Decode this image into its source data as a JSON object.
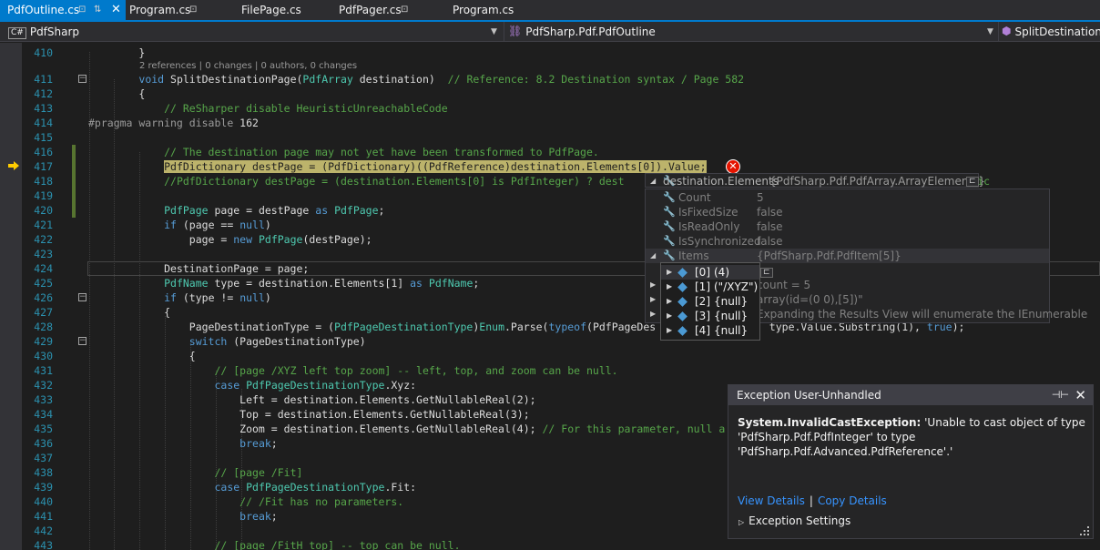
{
  "tabs": [
    {
      "label": "PdfOutline.cs",
      "active": true,
      "pinned": true,
      "close": "✕"
    },
    {
      "label": "Program.cs",
      "active": false,
      "pinned": true
    },
    {
      "label": "FilePage.cs",
      "active": false,
      "pinned": false
    },
    {
      "label": "PdfPager.cs",
      "active": false,
      "pinned": true
    },
    {
      "label": "Program.cs",
      "active": false,
      "pinned": false
    }
  ],
  "navbar": {
    "project_icon": "C#",
    "project": "PdfSharp",
    "type": "PdfSharp.Pdf.PdfOutline",
    "member": "SplitDestinationPage"
  },
  "codelens": "2 references | 0 changes | 0 authors, 0 changes",
  "lines": [
    {
      "n": "410",
      "html": "        }"
    },
    {
      "n": "411",
      "html": "        <span class=\"kw\">void</span> SplitDestinationPage(<span class=\"ty\">PdfArray</span> destination)  <span class=\"cm\">// Reference: 8.2 Destination syntax / Page 582</span>"
    },
    {
      "n": "412",
      "html": "        {"
    },
    {
      "n": "413",
      "html": "            <span class=\"cm\">// ReSharper disable HeuristicUnreachableCode</span>"
    },
    {
      "n": "414",
      "html": "<span class=\"pp\">#pragma warning disable</span> 162"
    },
    {
      "n": "415",
      "html": ""
    },
    {
      "n": "416",
      "html": "            <span class=\"cm\">// The destination page may not yet have been transformed to PdfPage.</span>"
    },
    {
      "n": "417",
      "html": "            <span class=\"hl\">PdfDictionary destPage = (PdfDictionary)((PdfReference)destination.Elements[0]).Value;</span>"
    },
    {
      "n": "418",
      "html": "            <span class=\"cm\">//PdfDictionary destPage = (destination.Elements[0] is PdfInteger) ? dest                                       ]).Value] : (PdfDic</span>"
    },
    {
      "n": "419",
      "html": ""
    },
    {
      "n": "420",
      "html": "            <span class=\"ty\">PdfPage</span> page = destPage <span class=\"kw\">as</span> <span class=\"ty\">PdfPage</span>;"
    },
    {
      "n": "421",
      "html": "            <span class=\"kw\">if</span> (page == <span class=\"kw\">null</span>)"
    },
    {
      "n": "422",
      "html": "                page = <span class=\"kw\">new</span> <span class=\"ty\">PdfPage</span>(destPage);"
    },
    {
      "n": "423",
      "html": ""
    },
    {
      "n": "424",
      "html": "            DestinationPage = page;"
    },
    {
      "n": "425",
      "html": "            <span class=\"ty\">PdfName</span> type = destination.Elements[1] <span class=\"kw\">as</span> <span class=\"ty\">PdfName</span>;"
    },
    {
      "n": "426",
      "html": "            <span class=\"kw\">if</span> (type != <span class=\"kw\">null</span>)"
    },
    {
      "n": "427",
      "html": "            {"
    },
    {
      "n": "428",
      "html": "                PageDestinationType = (<span class=\"ty\">PdfPageDestinationType</span>)<span class=\"ty\">Enum</span>.Parse(<span class=\"kw\">typeof</span>(PdfPageDes                  type.Value.Substring(1), <span class=\"kw\">true</span>);"
    },
    {
      "n": "429",
      "html": "                <span class=\"kw\">switch</span> (PageDestinationType)"
    },
    {
      "n": "430",
      "html": "                {"
    },
    {
      "n": "431",
      "html": "                    <span class=\"cm\">// [page /XYZ left top zoom] -- left, top, and zoom can be null.</span>"
    },
    {
      "n": "432",
      "html": "                    <span class=\"kw\">case</span> <span class=\"ty\">PdfPageDestinationType</span>.Xyz:"
    },
    {
      "n": "433",
      "html": "                        Left = destination.Elements.GetNullableReal(2);"
    },
    {
      "n": "434",
      "html": "                        Top = destination.Elements.GetNullableReal(3);"
    },
    {
      "n": "435",
      "html": "                        Zoom = destination.Elements.GetNullableReal(4); <span class=\"cm\">// For this parameter, null a</span>"
    },
    {
      "n": "436",
      "html": "                        <span class=\"kw\">break</span>;"
    },
    {
      "n": "437",
      "html": ""
    },
    {
      "n": "438",
      "html": "                    <span class=\"cm\">// [page /Fit]</span>"
    },
    {
      "n": "439",
      "html": "                    <span class=\"kw\">case</span> <span class=\"ty\">PdfPageDestinationType</span>.Fit:"
    },
    {
      "n": "440",
      "html": "                        <span class=\"cm\">// /Fit has no parameters.</span>"
    },
    {
      "n": "441",
      "html": "                        <span class=\"kw\">break</span>;"
    },
    {
      "n": "442",
      "html": ""
    },
    {
      "n": "443",
      "html": "                    <span class=\"cm\">// [page /FitH top] -- top can be null.</span>"
    }
  ],
  "datatip": {
    "header": {
      "name": "destination.Elements",
      "value": "{PdfSharp.Pdf.PdfArray.ArrayElements}"
    },
    "rows": [
      {
        "name": "Count",
        "value": "5"
      },
      {
        "name": "IsFixedSize",
        "value": "false"
      },
      {
        "name": "IsReadOnly",
        "value": "false"
      },
      {
        "name": "IsSynchronized",
        "value": "false"
      },
      {
        "name": "Items",
        "value": "{PdfSharp.Pdf.PdfItem[5]}"
      }
    ],
    "hidden_rows": [
      {
        "text": "count = 5"
      },
      {
        "text": "array(id=(0 0),[5])\""
      },
      {
        "text": "Expanding the Results View will enumerate the IEnumerable"
      }
    ],
    "items": [
      {
        "index": "[0]",
        "value": "(4)"
      },
      {
        "index": "[1]",
        "value": "(\"/XYZ\")"
      },
      {
        "index": "[2]",
        "value": "{null}"
      },
      {
        "index": "[3]",
        "value": "{null}"
      },
      {
        "index": "[4]",
        "value": "{null}"
      }
    ]
  },
  "exception": {
    "title": "Exception User-Unhandled",
    "type": "System.InvalidCastException:",
    "message": "'Unable to cast object of type 'PdfSharp.Pdf.PdfInteger' to type 'PdfSharp.Pdf.Advanced.PdfReference'.'",
    "view_details": "View Details",
    "separator": "|",
    "copy_details": "Copy Details",
    "settings": "Exception Settings"
  },
  "colors": {
    "accent": "#007acc",
    "error": "#e51400",
    "highlight": "#bcb36b",
    "keyword": "#569cd6",
    "type": "#4ec9b0",
    "comment": "#57a64a"
  }
}
